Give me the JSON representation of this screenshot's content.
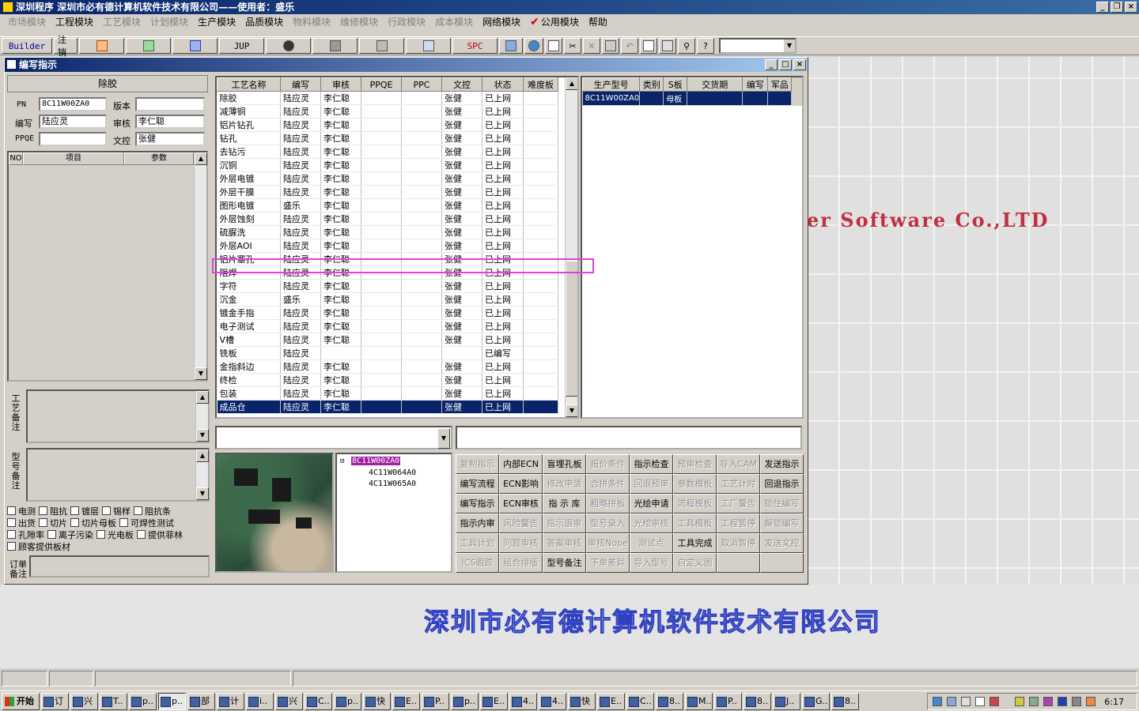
{
  "app": {
    "title": "深圳程序   深圳市必有德计算机软件技术有限公司——使用者：盛乐"
  },
  "menu": [
    {
      "label": "市场模块",
      "enabled": false
    },
    {
      "label": "工程模块",
      "enabled": true
    },
    {
      "label": "工艺模块",
      "enabled": false
    },
    {
      "label": "计划模块",
      "enabled": false
    },
    {
      "label": "生产模块",
      "enabled": true
    },
    {
      "label": "品质模块",
      "enabled": true
    },
    {
      "label": "物料模块",
      "enabled": false
    },
    {
      "label": "维修模块",
      "enabled": false
    },
    {
      "label": "行政模块",
      "enabled": false
    },
    {
      "label": "成本模块",
      "enabled": false
    },
    {
      "label": "网络模块",
      "enabled": true
    },
    {
      "label": "公用模块",
      "enabled": true
    },
    {
      "label": "帮助",
      "enabled": true
    }
  ],
  "toolbar": {
    "builder": "Builder",
    "logout": "注销",
    "jup": "JUP",
    "spc": "SPC"
  },
  "window": {
    "title": "编写指示"
  },
  "left": {
    "process_name": "除胶",
    "labels": {
      "pn": "PN",
      "version": "版本",
      "author": "编写",
      "review": "审核",
      "ppqe": "PPQE",
      "doc_control": "文控"
    },
    "values": {
      "pn": "8C11W00ZA0",
      "version": "",
      "author": "陆应灵",
      "review": "李仁聪",
      "ppqe": "",
      "doc_control": "张健"
    },
    "mini_grid_headers": [
      "NO",
      "项目",
      "参数"
    ],
    "process_note_label": "工艺备注",
    "model_note_label": "型号备注",
    "order_note_label": "订单备注",
    "checkboxes": [
      [
        "电测",
        "阻抗",
        "镀层",
        "锡样",
        "阻抗条"
      ],
      [
        "出货",
        "切片",
        "切片母板",
        "可焊性测试"
      ],
      [
        "孔隙率",
        "离子污染",
        "光电板",
        "提供菲林"
      ],
      [
        "顾客提供板材"
      ]
    ]
  },
  "grid": {
    "headers": [
      "工艺名称",
      "编写",
      "审核",
      "PPQE",
      "PPC",
      "文控",
      "状态",
      "难度板"
    ],
    "rows": [
      [
        "除胶",
        "陆应灵",
        "李仁聪",
        "",
        "",
        "张健",
        "已上网",
        ""
      ],
      [
        "减薄铜",
        "陆应灵",
        "李仁聪",
        "",
        "",
        "张健",
        "已上网",
        ""
      ],
      [
        "铝片钻孔",
        "陆应灵",
        "李仁聪",
        "",
        "",
        "张健",
        "已上网",
        ""
      ],
      [
        "钻孔",
        "陆应灵",
        "李仁聪",
        "",
        "",
        "张健",
        "已上网",
        ""
      ],
      [
        "去钻污",
        "陆应灵",
        "李仁聪",
        "",
        "",
        "张健",
        "已上网",
        ""
      ],
      [
        "沉铜",
        "陆应灵",
        "李仁聪",
        "",
        "",
        "张健",
        "已上网",
        ""
      ],
      [
        "外层电镀",
        "陆应灵",
        "李仁聪",
        "",
        "",
        "张健",
        "已上网",
        ""
      ],
      [
        "外层干膜",
        "陆应灵",
        "李仁聪",
        "",
        "",
        "张健",
        "已上网",
        ""
      ],
      [
        "图形电镀",
        "盛乐",
        "李仁聪",
        "",
        "",
        "张健",
        "已上网",
        ""
      ],
      [
        "外层蚀刻",
        "陆应灵",
        "李仁聪",
        "",
        "",
        "张健",
        "已上网",
        ""
      ],
      [
        "硫脲洗",
        "陆应灵",
        "李仁聪",
        "",
        "",
        "张健",
        "已上网",
        ""
      ],
      [
        "外层AOI",
        "陆应灵",
        "李仁聪",
        "",
        "",
        "张健",
        "已上网",
        ""
      ],
      [
        "铝片塞孔",
        "陆应灵",
        "李仁聪",
        "",
        "",
        "张健",
        "已上网",
        ""
      ],
      [
        "阻焊",
        "陆应灵",
        "李仁聪",
        "",
        "",
        "张健",
        "已上网",
        ""
      ],
      [
        "字符",
        "陆应灵",
        "李仁聪",
        "",
        "",
        "张健",
        "已上网",
        ""
      ],
      [
        "沉金",
        "盛乐",
        "李仁聪",
        "",
        "",
        "张健",
        "已上网",
        ""
      ],
      [
        "镀金手指",
        "陆应灵",
        "李仁聪",
        "",
        "",
        "张健",
        "已上网",
        ""
      ],
      [
        "电子测试",
        "陆应灵",
        "李仁聪",
        "",
        "",
        "张健",
        "已上网",
        ""
      ],
      [
        "V槽",
        "陆应灵",
        "李仁聪",
        "",
        "",
        "张健",
        "已上网",
        ""
      ],
      [
        "铣板",
        "陆应灵",
        "",
        "",
        "",
        "",
        "已编写",
        ""
      ],
      [
        "金指斜边",
        "陆应灵",
        "李仁聪",
        "",
        "",
        "张健",
        "已上网",
        ""
      ],
      [
        "终检",
        "陆应灵",
        "李仁聪",
        "",
        "",
        "张健",
        "已上网",
        ""
      ],
      [
        "包装",
        "陆应灵",
        "李仁聪",
        "",
        "",
        "张健",
        "已上网",
        ""
      ],
      [
        "成品仓",
        "陆应灵",
        "李仁聪",
        "",
        "",
        "张健",
        "已上网",
        ""
      ]
    ],
    "selected_row": 23,
    "highlighted_row": 17
  },
  "grid2": {
    "headers": [
      "生产型号",
      "类别",
      "S板",
      "交货期",
      "编写",
      "军品"
    ],
    "row": [
      "8C11W00ZA0",
      "",
      "母板",
      "",
      "",
      ""
    ]
  },
  "tree": {
    "root": "8C11W00ZA0",
    "children": [
      "4C11W064A0",
      "4C11W065A0"
    ]
  },
  "buttons": [
    {
      "label": "复制指示",
      "enabled": false
    },
    {
      "label": "内部ECN",
      "enabled": true
    },
    {
      "label": "盲埋孔板",
      "enabled": true
    },
    {
      "label": "报价条件",
      "enabled": false
    },
    {
      "label": "指示检查",
      "enabled": true
    },
    {
      "label": "预审检查",
      "enabled": false
    },
    {
      "label": "导入CAM",
      "enabled": false
    },
    {
      "label": "发送指示",
      "enabled": true
    },
    {
      "label": "编写流程",
      "enabled": true
    },
    {
      "label": "ECN影响",
      "enabled": true
    },
    {
      "label": "修改申请",
      "enabled": false
    },
    {
      "label": "合拼条件",
      "enabled": false
    },
    {
      "label": "回退预审",
      "enabled": false
    },
    {
      "label": "参数模板",
      "enabled": false
    },
    {
      "label": "工艺计时",
      "enabled": false
    },
    {
      "label": "回退指示",
      "enabled": true
    },
    {
      "label": "编写指示",
      "enabled": true
    },
    {
      "label": "ECN审核",
      "enabled": true
    },
    {
      "label": "指 示 库",
      "enabled": true
    },
    {
      "label": "粗略拼板",
      "enabled": false
    },
    {
      "label": "光绘申请",
      "enabled": true
    },
    {
      "label": "流程模板",
      "enabled": false
    },
    {
      "label": "工厂警告",
      "enabled": false
    },
    {
      "label": "锁住编写",
      "enabled": false
    },
    {
      "label": "指示内审",
      "enabled": true
    },
    {
      "label": "风险警告",
      "enabled": false
    },
    {
      "label": "指示退审",
      "enabled": false
    },
    {
      "label": "型号录入",
      "enabled": false
    },
    {
      "label": "光绘审核",
      "enabled": false
    },
    {
      "label": "工具模板",
      "enabled": false
    },
    {
      "label": "工程暂停",
      "enabled": false
    },
    {
      "label": "解锁编写",
      "enabled": false
    },
    {
      "label": "工具计划",
      "enabled": false
    },
    {
      "label": "问题审核",
      "enabled": false
    },
    {
      "label": "答案审核",
      "enabled": false
    },
    {
      "label": "审核Nope",
      "enabled": false
    },
    {
      "label": "测试点",
      "enabled": false
    },
    {
      "label": "工具完成",
      "enabled": true
    },
    {
      "label": "取消暂停",
      "enabled": false
    },
    {
      "label": "发送文控",
      "enabled": false
    },
    {
      "label": "ICS跟踪",
      "enabled": false
    },
    {
      "label": "组合排版",
      "enabled": false
    },
    {
      "label": "型号备注",
      "enabled": true
    },
    {
      "label": "下单差异",
      "enabled": false
    },
    {
      "label": "导入型号",
      "enabled": false
    },
    {
      "label": "自定义图",
      "enabled": false
    }
  ],
  "background": {
    "company_en": "er Software Co.,LTD",
    "company_cn": "深圳市必有德计算机软件技术有限公司"
  },
  "taskbar": {
    "start": "开始",
    "tasks": [
      "订",
      "兴",
      "T..",
      "p..",
      "p..",
      "部",
      "计",
      "i..",
      "兴",
      "C..",
      "p..",
      "快",
      "E..",
      "P..",
      "p..",
      "E..",
      "4..",
      "4..",
      "快",
      "E..",
      "C..",
      "8..",
      "M..",
      "P..",
      "8..",
      "J..",
      "G..",
      "8.."
    ],
    "active_task": 4,
    "clock": "6:17"
  }
}
